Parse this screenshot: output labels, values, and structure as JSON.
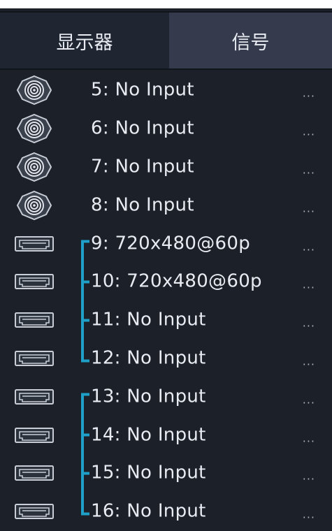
{
  "tabs": [
    {
      "label": "显示器",
      "active": false
    },
    {
      "label": "信号",
      "active": true
    }
  ],
  "more_label": "...",
  "rows": [
    {
      "label": "5: No Input",
      "icon": "hdbnc-connector-icon"
    },
    {
      "label": "6: No Input",
      "icon": "hdbnc-connector-icon"
    },
    {
      "label": "7: No Input",
      "icon": "hdbnc-connector-icon"
    },
    {
      "label": "8: No Input",
      "icon": "hdbnc-connector-icon"
    },
    {
      "label": "9: 720x480@60p",
      "icon": "hdmi-port-icon"
    },
    {
      "label": "10: 720x480@60p",
      "icon": "hdmi-port-icon"
    },
    {
      "label": "11: No Input",
      "icon": "hdmi-port-icon"
    },
    {
      "label": "12: No Input",
      "icon": "hdmi-port-icon"
    },
    {
      "label": "13: No Input",
      "icon": "hdmi-port-icon"
    },
    {
      "label": "14: No Input",
      "icon": "hdmi-port-icon"
    },
    {
      "label": "15: No Input",
      "icon": "hdmi-port-icon"
    },
    {
      "label": "16: No Input",
      "icon": "hdmi-port-icon"
    }
  ],
  "groups": [
    {
      "from": "9",
      "to": "12"
    },
    {
      "from": "13",
      "to": "16"
    }
  ],
  "colors": {
    "background": "#1b2029",
    "tab_inactive": "#1f2632",
    "tab_active": "#353a4d",
    "bracket": "#1ea0c8",
    "text": "#e8ecf2"
  }
}
